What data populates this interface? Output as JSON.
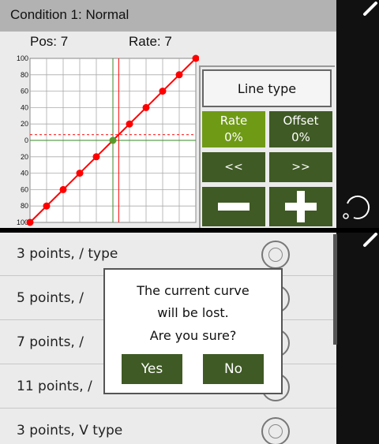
{
  "header": {
    "title": "Condition  1:  Normal",
    "pos_label": "Pos: 7",
    "rate_label": "Rate: 7"
  },
  "chart_data": {
    "type": "line",
    "x": [
      -100,
      -80,
      -60,
      -40,
      -20,
      0,
      20,
      40,
      60,
      80,
      100
    ],
    "y": [
      -100,
      -80,
      -60,
      -40,
      -20,
      0,
      20,
      40,
      60,
      80,
      100
    ],
    "xlim": [
      -100,
      100
    ],
    "ylim": [
      -100,
      100
    ],
    "y_tick_labels": [
      "100",
      "80",
      "60",
      "40",
      "20",
      "0",
      "20",
      "40",
      "60",
      "80",
      "100"
    ],
    "current_x": 7,
    "current_y": 7,
    "grid": true,
    "line_color": "#ff0000",
    "marker_color": "#ff0000",
    "center_marker_color": "#5a9a2a"
  },
  "controls": {
    "line_type_label": "Line  type",
    "rate_label": "Rate",
    "rate_value": "0%",
    "offset_label": "Offset",
    "offset_value": "0%",
    "prev_label": "<<",
    "next_label": ">>",
    "minus_icon": "minus-icon",
    "plus_icon": "plus-icon"
  },
  "list": {
    "items": [
      {
        "label": "3  points,  /  type"
      },
      {
        "label": "5  points,  /"
      },
      {
        "label": "7  points,  /"
      },
      {
        "label": "11  points,  /"
      },
      {
        "label": "3  points,  V  type"
      }
    ]
  },
  "dialog": {
    "line1": "The  current  curve",
    "line2": "will  be  lost.",
    "line3": "Are  you  sure?",
    "yes_label": "Yes",
    "no_label": "No"
  },
  "colors": {
    "dark_green": "#3f5a24",
    "light_green": "#6f9a16",
    "panel_bg": "#ebebeb",
    "header_bg": "#b2b2b2"
  }
}
